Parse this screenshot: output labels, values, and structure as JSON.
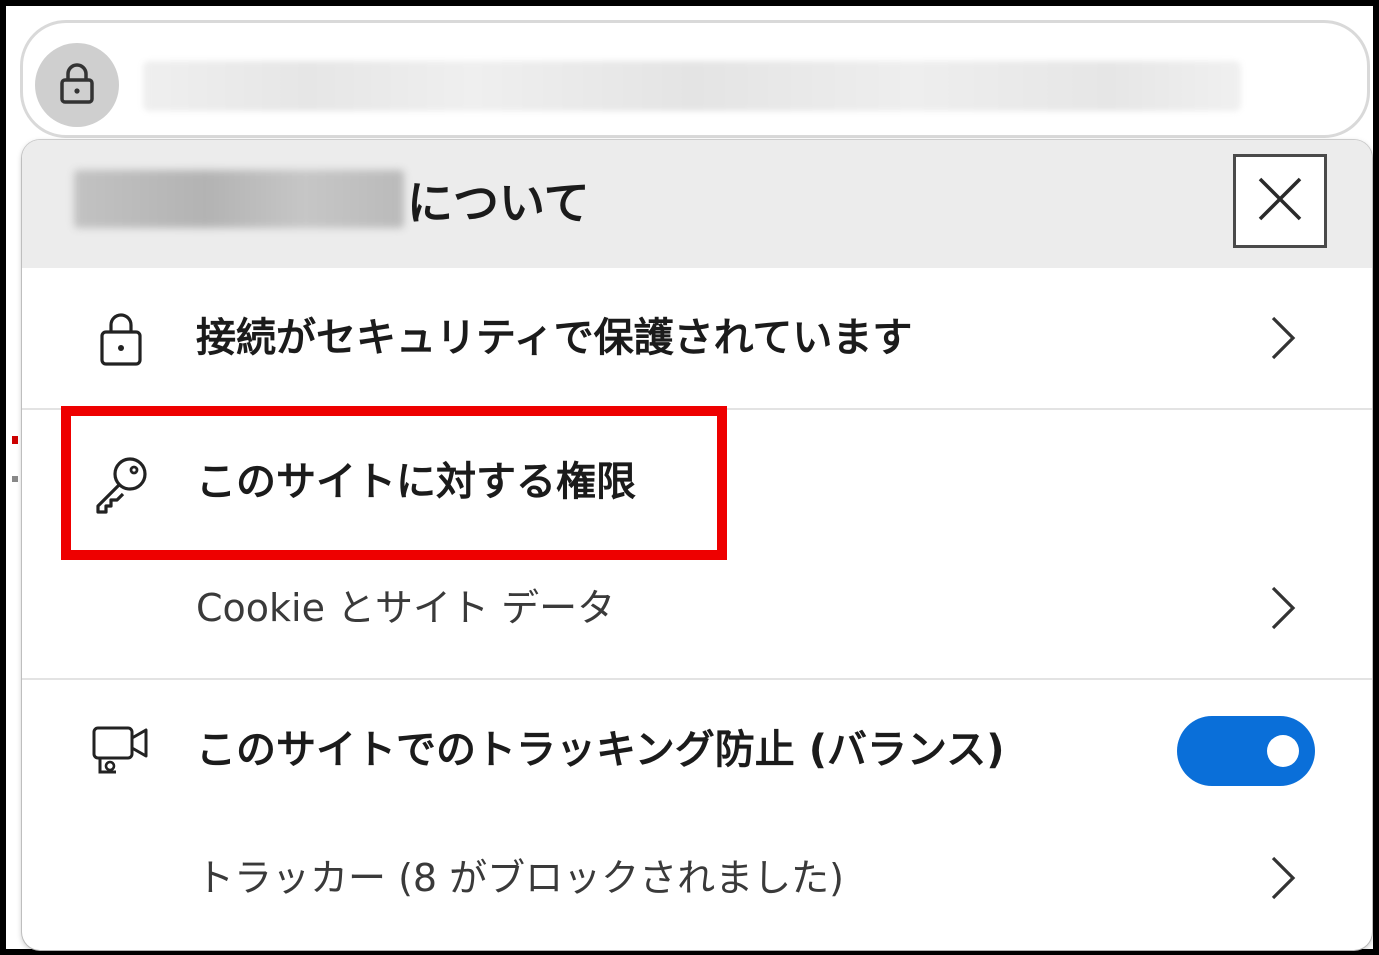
{
  "address_bar": {
    "lock_icon": "lock-icon"
  },
  "popup": {
    "header_suffix": "について",
    "close_icon": "close-icon",
    "connection": {
      "label": "接続がセキュリティで保護されています",
      "icon": "lock-icon"
    },
    "permissions": {
      "label": "このサイトに対する権限",
      "icon": "key-icon"
    },
    "cookies": {
      "label": "Cookie とサイト データ"
    },
    "tracking": {
      "label": "このサイトでのトラッキング防止 (バランス)",
      "icon": "tracking-camera-icon",
      "enabled": true
    },
    "trackers": {
      "label": "トラッカー (8 がブロックされました)"
    }
  },
  "colors": {
    "toggle_on": "#0a6fd9",
    "highlight": "#ee0000",
    "header_bg": "#ececec"
  }
}
